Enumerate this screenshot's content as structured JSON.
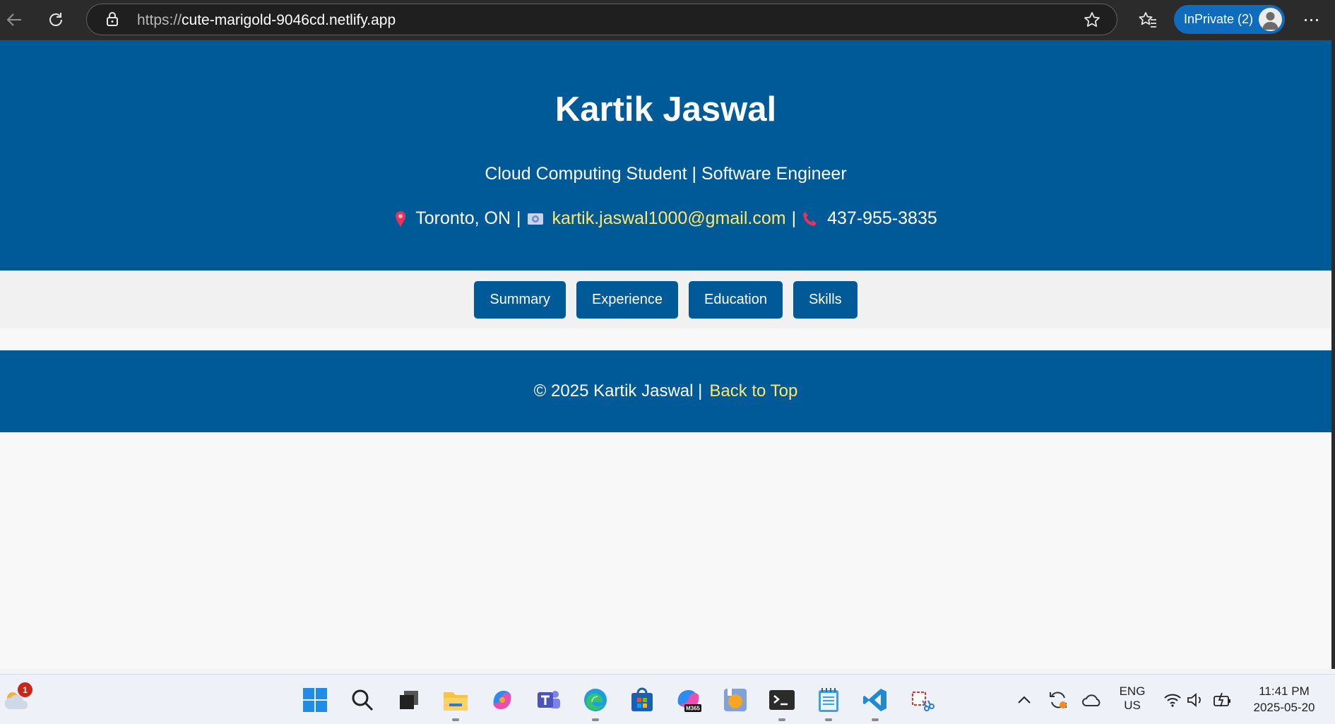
{
  "browser": {
    "url_protocol": "https://",
    "url_host": "cute-marigold-9046cd.netlify.app",
    "inprivate_label": "InPrivate (2)",
    "more_label": "⋯"
  },
  "header": {
    "name": "Kartik Jaswal",
    "subtitle": "Cloud Computing Student | Software Engineer",
    "location": "Toronto, ON",
    "separator": "|",
    "email": "kartik.jaswal1000@gmail.com",
    "phone": "437-955-3835"
  },
  "nav": {
    "items": [
      {
        "label": "Summary"
      },
      {
        "label": "Experience"
      },
      {
        "label": "Education"
      },
      {
        "label": "Skills"
      }
    ]
  },
  "footer": {
    "copyright": "© 2025 Kartik Jaswal |",
    "back_to_top": "Back to Top"
  },
  "taskbar": {
    "weather_badge": "1",
    "lang_line1": "ENG",
    "lang_line2": "US",
    "time": "11:41 PM",
    "date": "2025-05-20",
    "icons": [
      "weather-icon",
      "start-icon",
      "search-icon",
      "task-view-icon",
      "file-explorer-icon",
      "copilot-icon",
      "teams-icon",
      "edge-icon",
      "store-icon",
      "m365-icon",
      "app-icon",
      "terminal-icon",
      "notepad-icon",
      "vscode-icon",
      "snipping-tool-icon"
    ]
  },
  "colors": {
    "brand_blue": "#005a97",
    "link_yellow": "#ffe66d",
    "edge_blue": "#0f6cbd"
  }
}
